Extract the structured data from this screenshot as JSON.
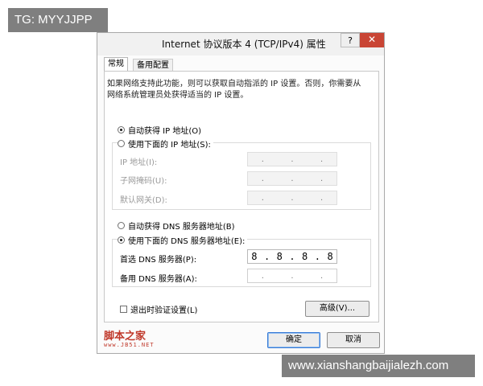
{
  "overlay": {
    "tag_text": "TG: MYYJJPP",
    "footer_text": "www.xianshangbaijialezh.com"
  },
  "window": {
    "title": "Internet 协议版本 4 (TCP/IPv4) 属性",
    "help_label": "?",
    "close_label": "✕"
  },
  "tabs": [
    {
      "label": "常规",
      "selected": true
    },
    {
      "label": "备用配置",
      "selected": false
    }
  ],
  "general": {
    "description": "如果网络支持此功能，则可以获取自动指派的 IP 设置。否则，你需要从网络系统管理员处获得适当的 IP 设置。",
    "ip_auto_label": "自动获得 IP 地址(O)",
    "ip_manual_label": "使用下面的 IP 地址(S):",
    "ip_address_label": "IP 地址(I):",
    "subnet_label": "子网掩码(U):",
    "gateway_label": "默认网关(D):",
    "dns_auto_label": "自动获得 DNS 服务器地址(B)",
    "dns_manual_label": "使用下面的 DNS 服务器地址(E):",
    "preferred_dns_label": "首选 DNS 服务器(P):",
    "alternate_dns_label": "备用 DNS 服务器(A):",
    "preferred_dns_octets": [
      "8",
      "8",
      "8",
      "8"
    ],
    "empty_dot": ".",
    "validate_label": "退出时验证设置(L)",
    "advanced_label": "高级(V)..."
  },
  "selection": {
    "ip_mode": "auto",
    "dns_mode": "manual",
    "validate_checked": false
  },
  "footer_buttons": {
    "ok_label": "确定",
    "cancel_label": "取消"
  },
  "watermark": {
    "title": "脚本之家",
    "url": "www.JB51.NET"
  },
  "colors": {
    "close_button": "#c94535",
    "default_button_border": "#3a7bd5",
    "watermark": "#c0392b"
  }
}
